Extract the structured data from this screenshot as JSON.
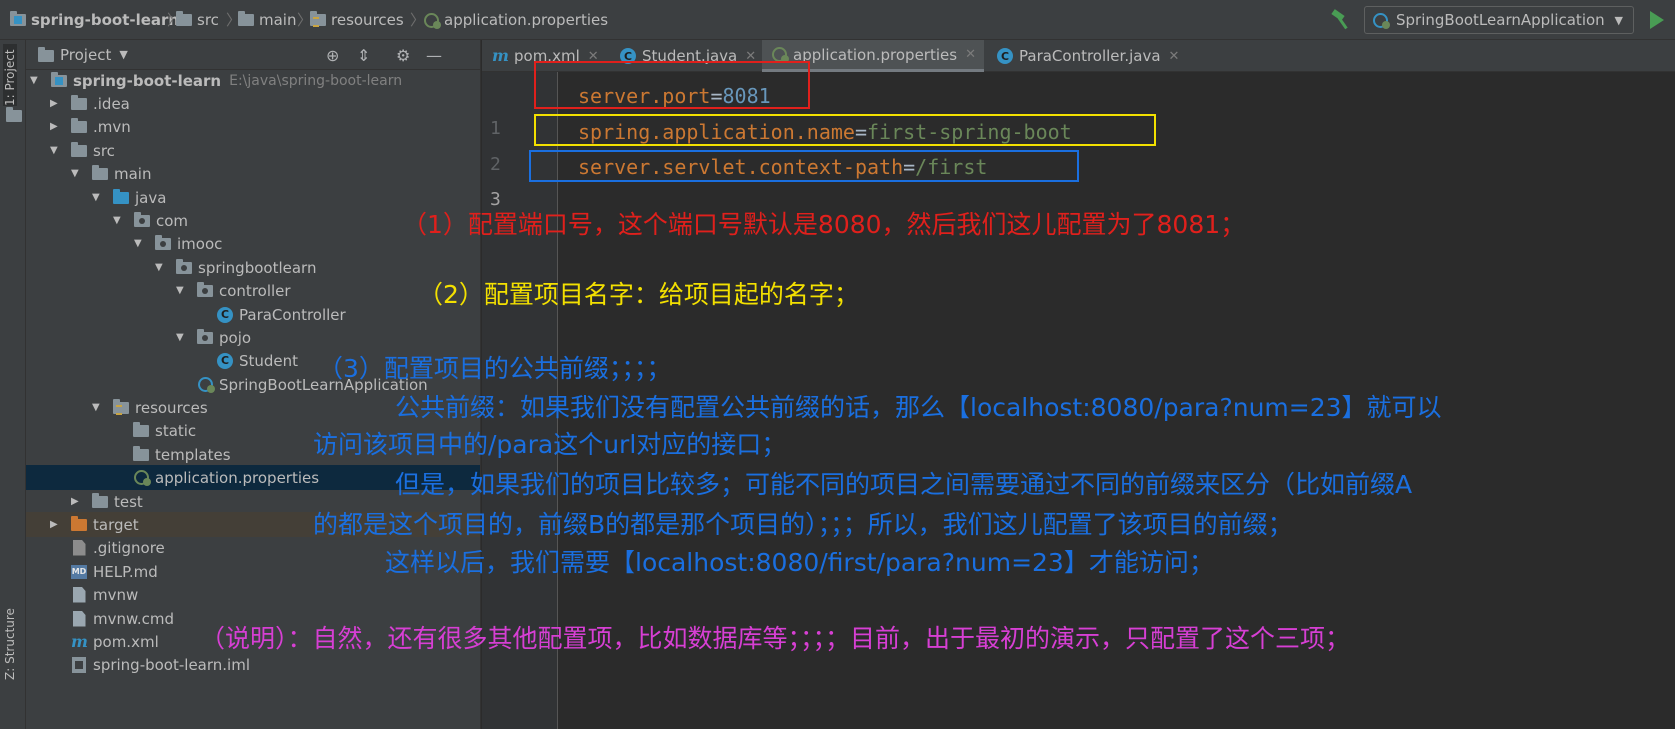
{
  "breadcrumbs": [
    "spring-boot-learn",
    "src",
    "main",
    "resources",
    "application.properties"
  ],
  "run_config": {
    "label": "SpringBootLearnApplication"
  },
  "left_strip": {
    "project_tab": "1: Project",
    "structure_tab": "Z: Structure"
  },
  "project_panel": {
    "title": "Project",
    "tree": {
      "root": {
        "name": "spring-boot-learn",
        "path": "E:\\java\\spring-boot-learn"
      },
      "idea": ".idea",
      "mvn": ".mvn",
      "src": "src",
      "main": "main",
      "java": "java",
      "com": "com",
      "imooc": "imooc",
      "springbootlearn": "springbootlearn",
      "controller": "controller",
      "ParaController": "ParaController",
      "pojo": "pojo",
      "Student": "Student",
      "SpringBootLearnApplication": "SpringBootLearnApplication",
      "resources": "resources",
      "static": "static",
      "templates": "templates",
      "application_properties": "application.properties",
      "test": "test",
      "target": "target",
      "gitignore": ".gitignore",
      "help_md": "HELP.md",
      "mvnw": "mvnw",
      "mvnw_cmd": "mvnw.cmd",
      "pom_xml": "pom.xml",
      "iml": "spring-boot-learn.iml"
    }
  },
  "editor": {
    "tabs": [
      {
        "label": "pom.xml",
        "icon": "maven-icon"
      },
      {
        "label": "Student.java",
        "icon": "class-icon"
      },
      {
        "label": "application.properties",
        "icon": "properties-icon",
        "active": true
      },
      {
        "label": "ParaController.java",
        "icon": "class-icon"
      }
    ],
    "lines": [
      {
        "number": "1",
        "key": "server.port",
        "eq": "=",
        "value": "8081"
      },
      {
        "number": "2",
        "key": "spring.application.name",
        "eq": "=",
        "value": "first-spring-boot"
      },
      {
        "number": "3",
        "key": "server.servlet.context-path",
        "eq": "=",
        "value": "/first"
      }
    ]
  },
  "annotations": {
    "a1": "（1）配置端口号，这个端口号默认是8080，然后我们这儿配置为了8081；",
    "a2": "（2）配置项目名字：给项目起的名字；",
    "a3": "（3）配置项目的公共前缀；；；；",
    "a3_1": "公共前缀：如果我们没有配置公共前缀的话，那么【localhost:8080/para?num=23】就可以",
    "a3_2": "访问该项目中的/para这个url对应的接口；",
    "a3_3": "但是，如果我们的项目比较多；可能不同的项目之间需要通过不同的前缀来区分（比如前缀A",
    "a3_4": "的都是这个项目的，前缀B的都是那个项目的）；；；所以，我们这儿配置了该项目的前缀；",
    "a3_5": "这样以后，我们需要【localhost:8080/first/para?num=23】才能访问；",
    "a4": "（说明）：自然，还有很多其他配置项，比如数据库等；；；；目前，出于最初的演示，只配置了这个三项；"
  },
  "colors": {
    "annotation_red": "#e0201c",
    "annotation_yellow": "#f3e000",
    "annotation_blue": "#1a6fe0",
    "annotation_magenta": "#d73fd4",
    "property_key": "#cc7832",
    "property_value": "#6a8759",
    "property_number": "#6897bb"
  }
}
